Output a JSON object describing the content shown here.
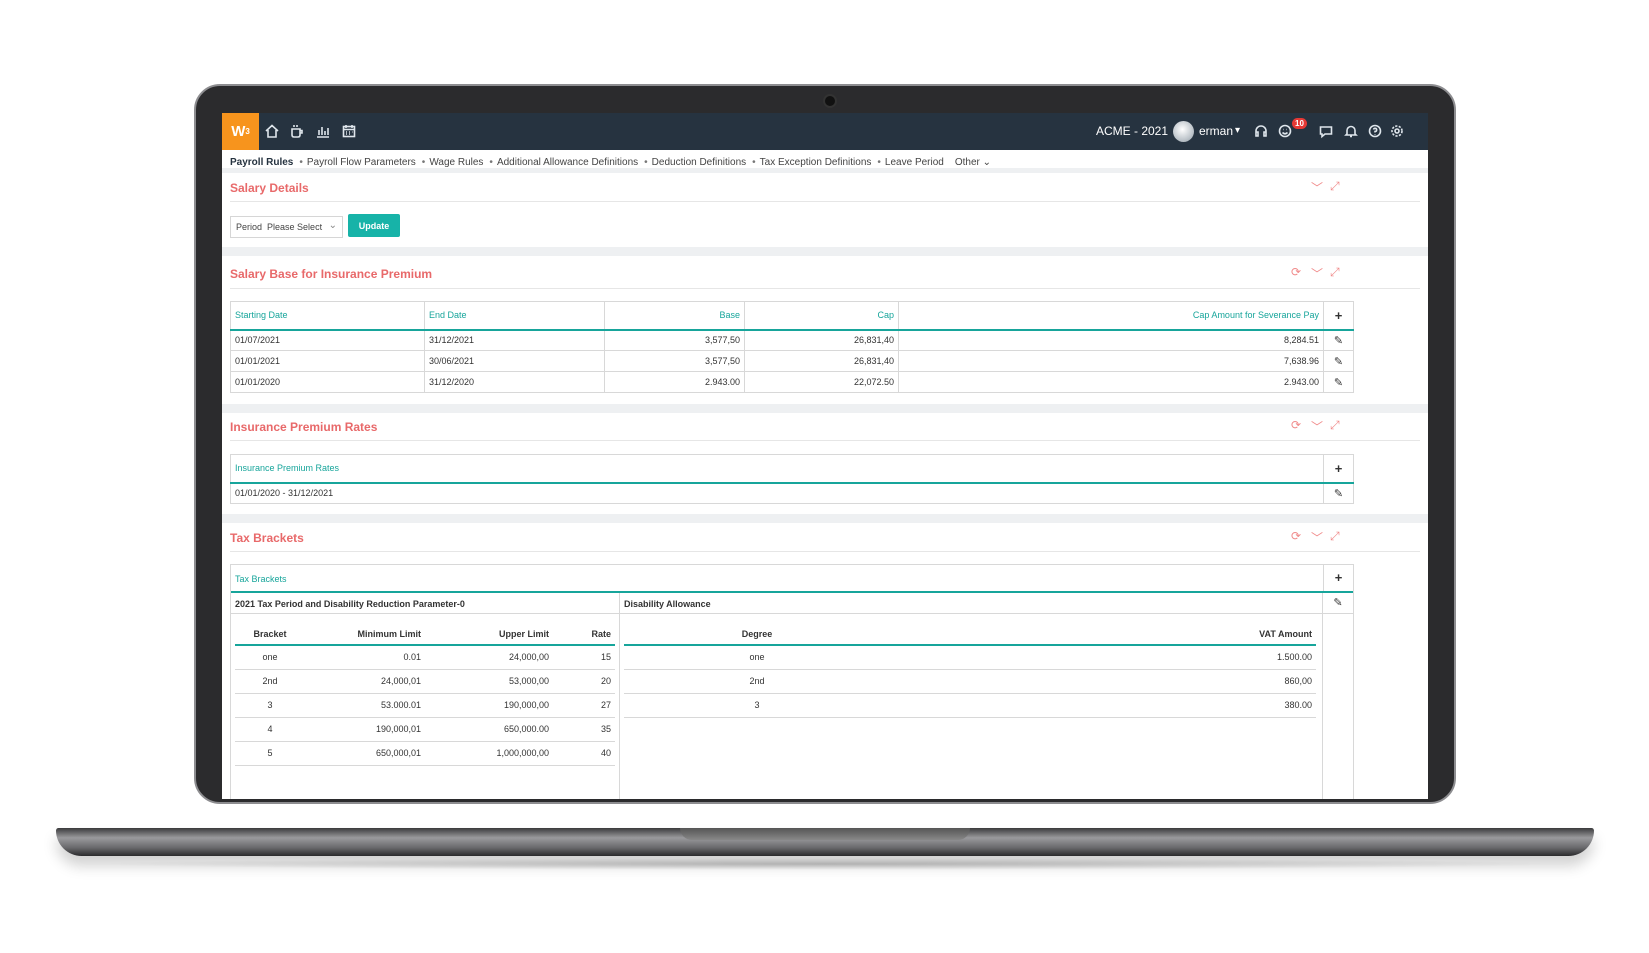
{
  "app": {
    "logo": "W",
    "logo_sup": "3",
    "company": "ACME - 2021",
    "username": "erman",
    "notification_count": "10"
  },
  "nav": {
    "active": "Payroll Rules",
    "items": [
      "Payroll Flow Parameters",
      "Wage Rules",
      "Additional Allowance Definitions",
      "Deduction Definitions",
      "Tax Exception Definitions",
      "Leave Period"
    ],
    "other": "Other"
  },
  "salary_details": {
    "title": "Salary Details",
    "period_label": "Period",
    "period_value": "Please Select",
    "update_label": "Update"
  },
  "salary_base": {
    "title": "Salary Base for Insurance Premium",
    "headers": [
      "Starting Date",
      "End Date",
      "Base",
      "Cap",
      "Cap Amount for Severance Pay"
    ],
    "rows": [
      [
        "01/07/2021",
        "31/12/2021",
        "3,577,50",
        "26,831,40",
        "8,284.51"
      ],
      [
        "01/01/2021",
        "30/06/2021",
        "3,577,50",
        "26,831,40",
        "7,638.96"
      ],
      [
        "01/01/2020",
        "31/12/2020",
        "2.943.00",
        "22,072.50",
        "2.943.00"
      ]
    ]
  },
  "insurance_rates": {
    "title": "Insurance Premium Rates",
    "header": "Insurance Premium Rates",
    "rows": [
      "01/01/2020 - 31/12/2021"
    ]
  },
  "tax_brackets": {
    "title": "Tax Brackets",
    "header": "Tax Brackets",
    "left_title": "2021 Tax Period and Disability Reduction Parameter-0",
    "right_title": "Disability Allowance",
    "bracket_headers": [
      "Bracket",
      "Minimum Limit",
      "Upper Limit",
      "Rate"
    ],
    "bracket_rows": [
      [
        "one",
        "0.01",
        "24,000,00",
        "15"
      ],
      [
        "2nd",
        "24,000,01",
        "53,000,00",
        "20"
      ],
      [
        "3",
        "53.000.01",
        "190,000,00",
        "27"
      ],
      [
        "4",
        "190,000,01",
        "650,000.00",
        "35"
      ],
      [
        "5",
        "650,000,01",
        "1,000,000,00",
        "40"
      ]
    ],
    "disability_headers": [
      "Degree",
      "VAT Amount"
    ],
    "disability_rows": [
      [
        "one",
        "1.500.00"
      ],
      [
        "2nd",
        "860,00"
      ],
      [
        "3",
        "380.00"
      ]
    ]
  },
  "icons": {
    "plus": "+",
    "edit": "✎",
    "refresh": "⟳",
    "collapse": "﹀",
    "expand": "⤢",
    "chevron": "⌄"
  },
  "colors": {
    "accent": "#17a59b",
    "title": "#e8696a",
    "topbar": "#263340",
    "logo": "#f7941d"
  }
}
